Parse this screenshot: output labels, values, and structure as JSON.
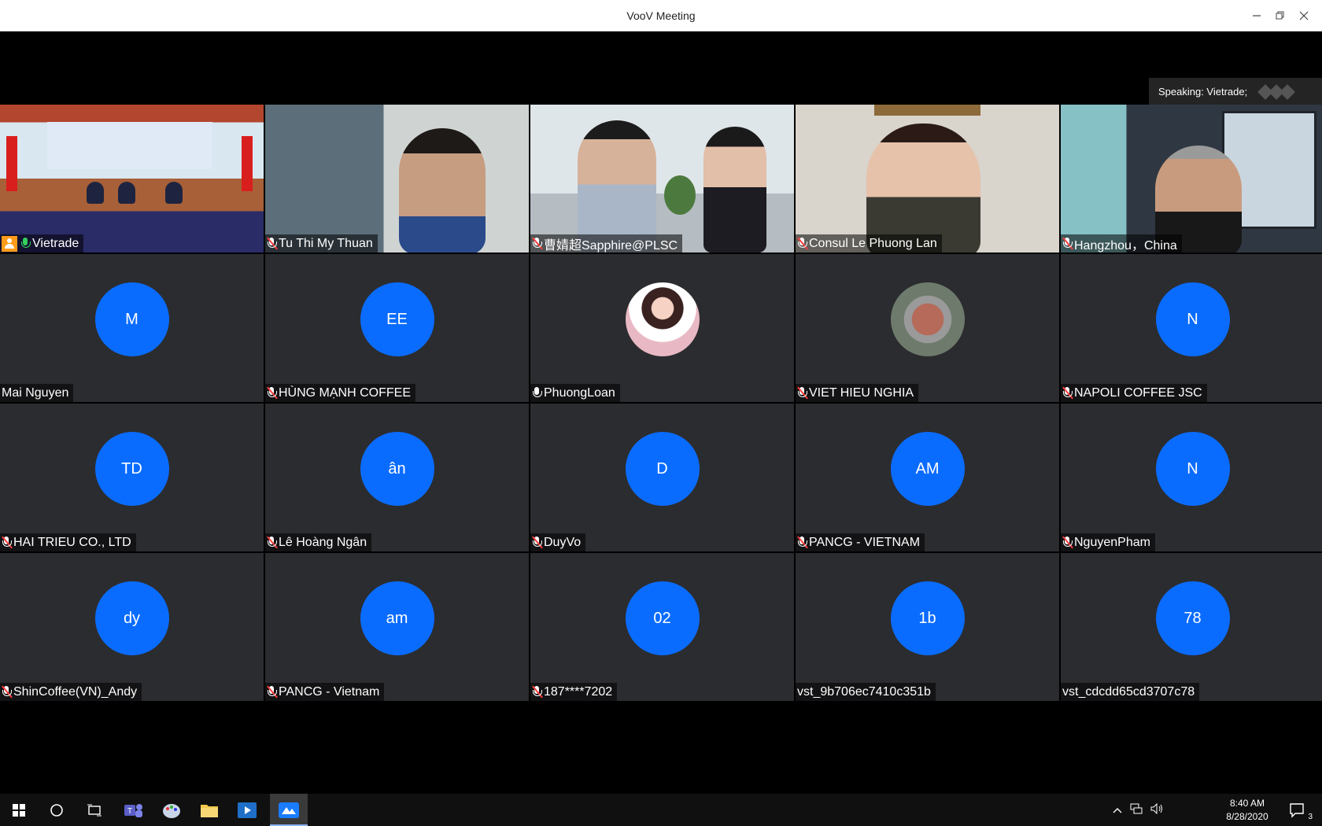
{
  "window": {
    "title": "VooV Meeting"
  },
  "speaking": {
    "label": "Speaking: Vietrade;"
  },
  "participants": [
    {
      "name": "Vietrade",
      "type": "video",
      "scene": "vietrade",
      "mic": "live",
      "host": true,
      "active": true
    },
    {
      "name": "Tu Thi My Thuan",
      "type": "video",
      "scene": "thuan",
      "mic": "muted"
    },
    {
      "name": "曹婧超Sapphire@PLSC",
      "type": "video",
      "scene": "plsc",
      "mic": "muted"
    },
    {
      "name": "Consul Le Phuong Lan",
      "type": "video",
      "scene": "lan",
      "mic": "muted"
    },
    {
      "name": "Hangzhou，China",
      "type": "video",
      "scene": "hz",
      "mic": "muted"
    },
    {
      "name": "Mai Nguyen",
      "type": "avatar",
      "initials": "M",
      "mic": "none"
    },
    {
      "name": "HÙNG MẠNH COFFEE",
      "type": "avatar",
      "initials": "EE",
      "mic": "muted"
    },
    {
      "name": "PhuongLoan",
      "type": "photo",
      "photo": "pink",
      "mic": "on"
    },
    {
      "name": "VIET HIEU NGHIA",
      "type": "photo",
      "photo": "map",
      "mic": "muted"
    },
    {
      "name": "NAPOLI COFFEE JSC",
      "type": "avatar",
      "initials": "N",
      "mic": "muted"
    },
    {
      "name": "HAI TRIEU CO., LTD",
      "type": "avatar",
      "initials": "TD",
      "mic": "muted"
    },
    {
      "name": "Lê Hoàng Ngân",
      "type": "avatar",
      "initials": "ân",
      "mic": "muted"
    },
    {
      "name": "DuyVo",
      "type": "avatar",
      "initials": "D",
      "mic": "muted"
    },
    {
      "name": "PANCG - VIETNAM",
      "type": "avatar",
      "initials": "AM",
      "mic": "muted"
    },
    {
      "name": "NguyenPham",
      "type": "avatar",
      "initials": "N",
      "mic": "muted"
    },
    {
      "name": "ShinCoffee(VN)_Andy",
      "type": "avatar",
      "initials": "dy",
      "mic": "muted"
    },
    {
      "name": "PANCG - Vietnam",
      "type": "avatar",
      "initials": "am",
      "mic": "muted"
    },
    {
      "name": "187****7202",
      "type": "avatar",
      "initials": "02",
      "mic": "muted"
    },
    {
      "name": "vst_9b706ec7410c351b",
      "type": "avatar",
      "initials": "1b",
      "mic": "none"
    },
    {
      "name": "vst_cdcdd65cd3707c78",
      "type": "avatar",
      "initials": "78",
      "mic": "none"
    }
  ],
  "colors": {
    "avatar": "#0a6cff",
    "tile": "#2b2c2f",
    "active_border": "#33c25a",
    "host_badge": "#ff9b1a"
  },
  "taskbar": {
    "apps": [
      "start-icon",
      "cortana-icon",
      "task-view-icon",
      "teams-icon",
      "paint-icon",
      "file-explorer-icon",
      "media-player-icon",
      "voov-meeting-icon"
    ],
    "clock": {
      "time": "8:40 AM",
      "date": "8/28/2020"
    },
    "notifications_count": "3"
  }
}
